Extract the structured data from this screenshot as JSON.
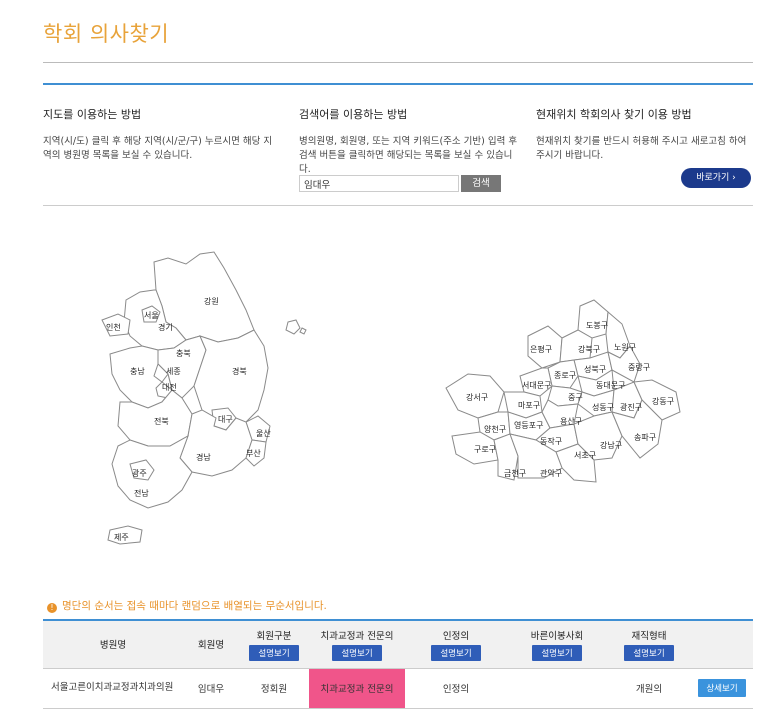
{
  "title": "학회 의사찾기",
  "guides": [
    {
      "heading": "지도를 이용하는 방법",
      "text": "지역(시/도) 클릭 후 해당 지역(시/군/구) 누르시면 해당 지역의 병원명 목록을 보실 수 있습니다."
    },
    {
      "heading": "검색어를 이용하는 방법",
      "text": "병의원명, 회원명, 또는 지역 키워드(주소 기반) 입력 후 검색 버튼을 클릭하면 해당되는 목록을 보실 수 있습니다."
    },
    {
      "heading": "현재위치 학회의사 찾기 이용 방법",
      "text": "현재위치 찾기를 반드시 허용해 주시고 새로고침 하여 주시기 바랍니다."
    }
  ],
  "search": {
    "value": "임대우",
    "button": "검색"
  },
  "location_button": "바로가기 ›",
  "korea_map": {
    "regions": [
      "강원",
      "인천",
      "서울",
      "경기",
      "충북",
      "충남",
      "세종",
      "대전",
      "경북",
      "전북",
      "대구",
      "울산",
      "경남",
      "부산",
      "광주",
      "전남",
      "제주"
    ]
  },
  "seoul_map": {
    "districts": [
      "도봉구",
      "은평구",
      "강북구",
      "노원구",
      "성북구",
      "중랑구",
      "종로구",
      "서대문구",
      "동대문구",
      "강서구",
      "마포구",
      "중구",
      "성동구",
      "광진구",
      "강동구",
      "양천구",
      "영등포구",
      "용산구",
      "구로구",
      "동작구",
      "강남구",
      "송파구",
      "서초구",
      "금천구",
      "관악구"
    ]
  },
  "notice": "명단의 순서는 접속 때마다 랜덤으로 배열되는 무순서입니다.",
  "table": {
    "headers": {
      "hospital": "병원명",
      "member": "회원명",
      "member_type": "회원구분",
      "specialist": "치과교정과 전문의",
      "certified": "인정의",
      "society": "바른이봉사회",
      "employment": "재직형태",
      "explain": "설명보기"
    },
    "rows": [
      {
        "hospital": "서울고른이치과교정과치과의원",
        "member": "임대우",
        "member_type": "정회원",
        "specialist": "치과교정과 전문의",
        "certified": "인정의",
        "society": "",
        "employment": "개원의",
        "detail": "상세보기"
      }
    ]
  },
  "colors": {
    "accent": "#e8a33a",
    "rule": "#3f8fd3",
    "highlight": "#f0558a",
    "navy": "#1c3a8c",
    "notice": "#e8922a"
  }
}
